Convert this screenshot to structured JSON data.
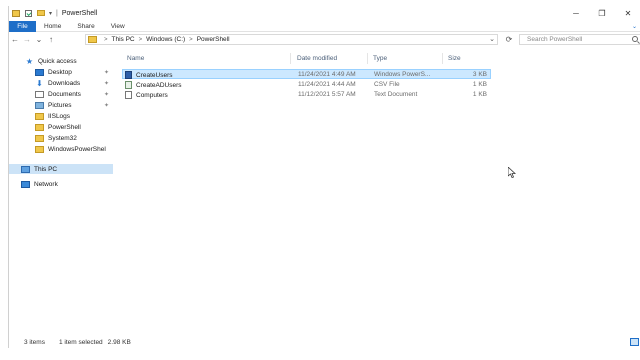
{
  "titlebar": {
    "title": "PowerShell",
    "separator": "|",
    "dropdown": "▾",
    "buttons": {
      "minimize": "─",
      "maximize": "❐",
      "close": "✕"
    }
  },
  "ribbon": {
    "tabs": [
      "File",
      "Home",
      "Share",
      "View"
    ],
    "expand": "⌄"
  },
  "nav": {
    "back": "←",
    "forward": "→",
    "recent": "⌄",
    "up": "↑",
    "crumbs": [
      "This PC",
      "Windows (C:)",
      "PowerShell"
    ],
    "crumb_sep": ">",
    "address_dropdown": "⌄",
    "refresh": "⟳",
    "search_placeholder": "Search PowerShell"
  },
  "sidebar": {
    "pin_glyph": "✦",
    "items": [
      {
        "label": "Quick access",
        "icon": "star-icon"
      },
      {
        "label": "Desktop",
        "icon": "desktop-icon",
        "pinned": true
      },
      {
        "label": "Downloads",
        "icon": "download-icon",
        "pinned": true
      },
      {
        "label": "Documents",
        "icon": "documents-icon",
        "pinned": true
      },
      {
        "label": "Pictures",
        "icon": "pictures-icon",
        "pinned": true
      },
      {
        "label": "IISLogs",
        "icon": "folder-icon"
      },
      {
        "label": "PowerShell",
        "icon": "folder-icon"
      },
      {
        "label": "System32",
        "icon": "folder-icon"
      },
      {
        "label": "WindowsPowerShel",
        "icon": "folder-icon"
      },
      {
        "label": "This PC",
        "icon": "computer-icon",
        "selected": true
      },
      {
        "label": "Network",
        "icon": "network-icon"
      }
    ]
  },
  "columns": [
    "Name",
    "Date modified",
    "Type",
    "Size"
  ],
  "files": [
    {
      "name": "CreateUsers",
      "date": "11/24/2021 4:49 AM",
      "type": "Windows PowerS...",
      "size": "3 KB",
      "selected": true,
      "kind": "ps"
    },
    {
      "name": "CreateADUsers",
      "date": "11/24/2021 4:44 AM",
      "type": "CSV File",
      "size": "1 KB",
      "selected": false,
      "kind": "csv"
    },
    {
      "name": "Computers",
      "date": "11/12/2021 5:57 AM",
      "type": "Text Document",
      "size": "1 KB",
      "selected": false,
      "kind": "txt"
    }
  ],
  "status": {
    "items": "3 items",
    "selected": "1 item selected",
    "size": "2.98 KB"
  }
}
